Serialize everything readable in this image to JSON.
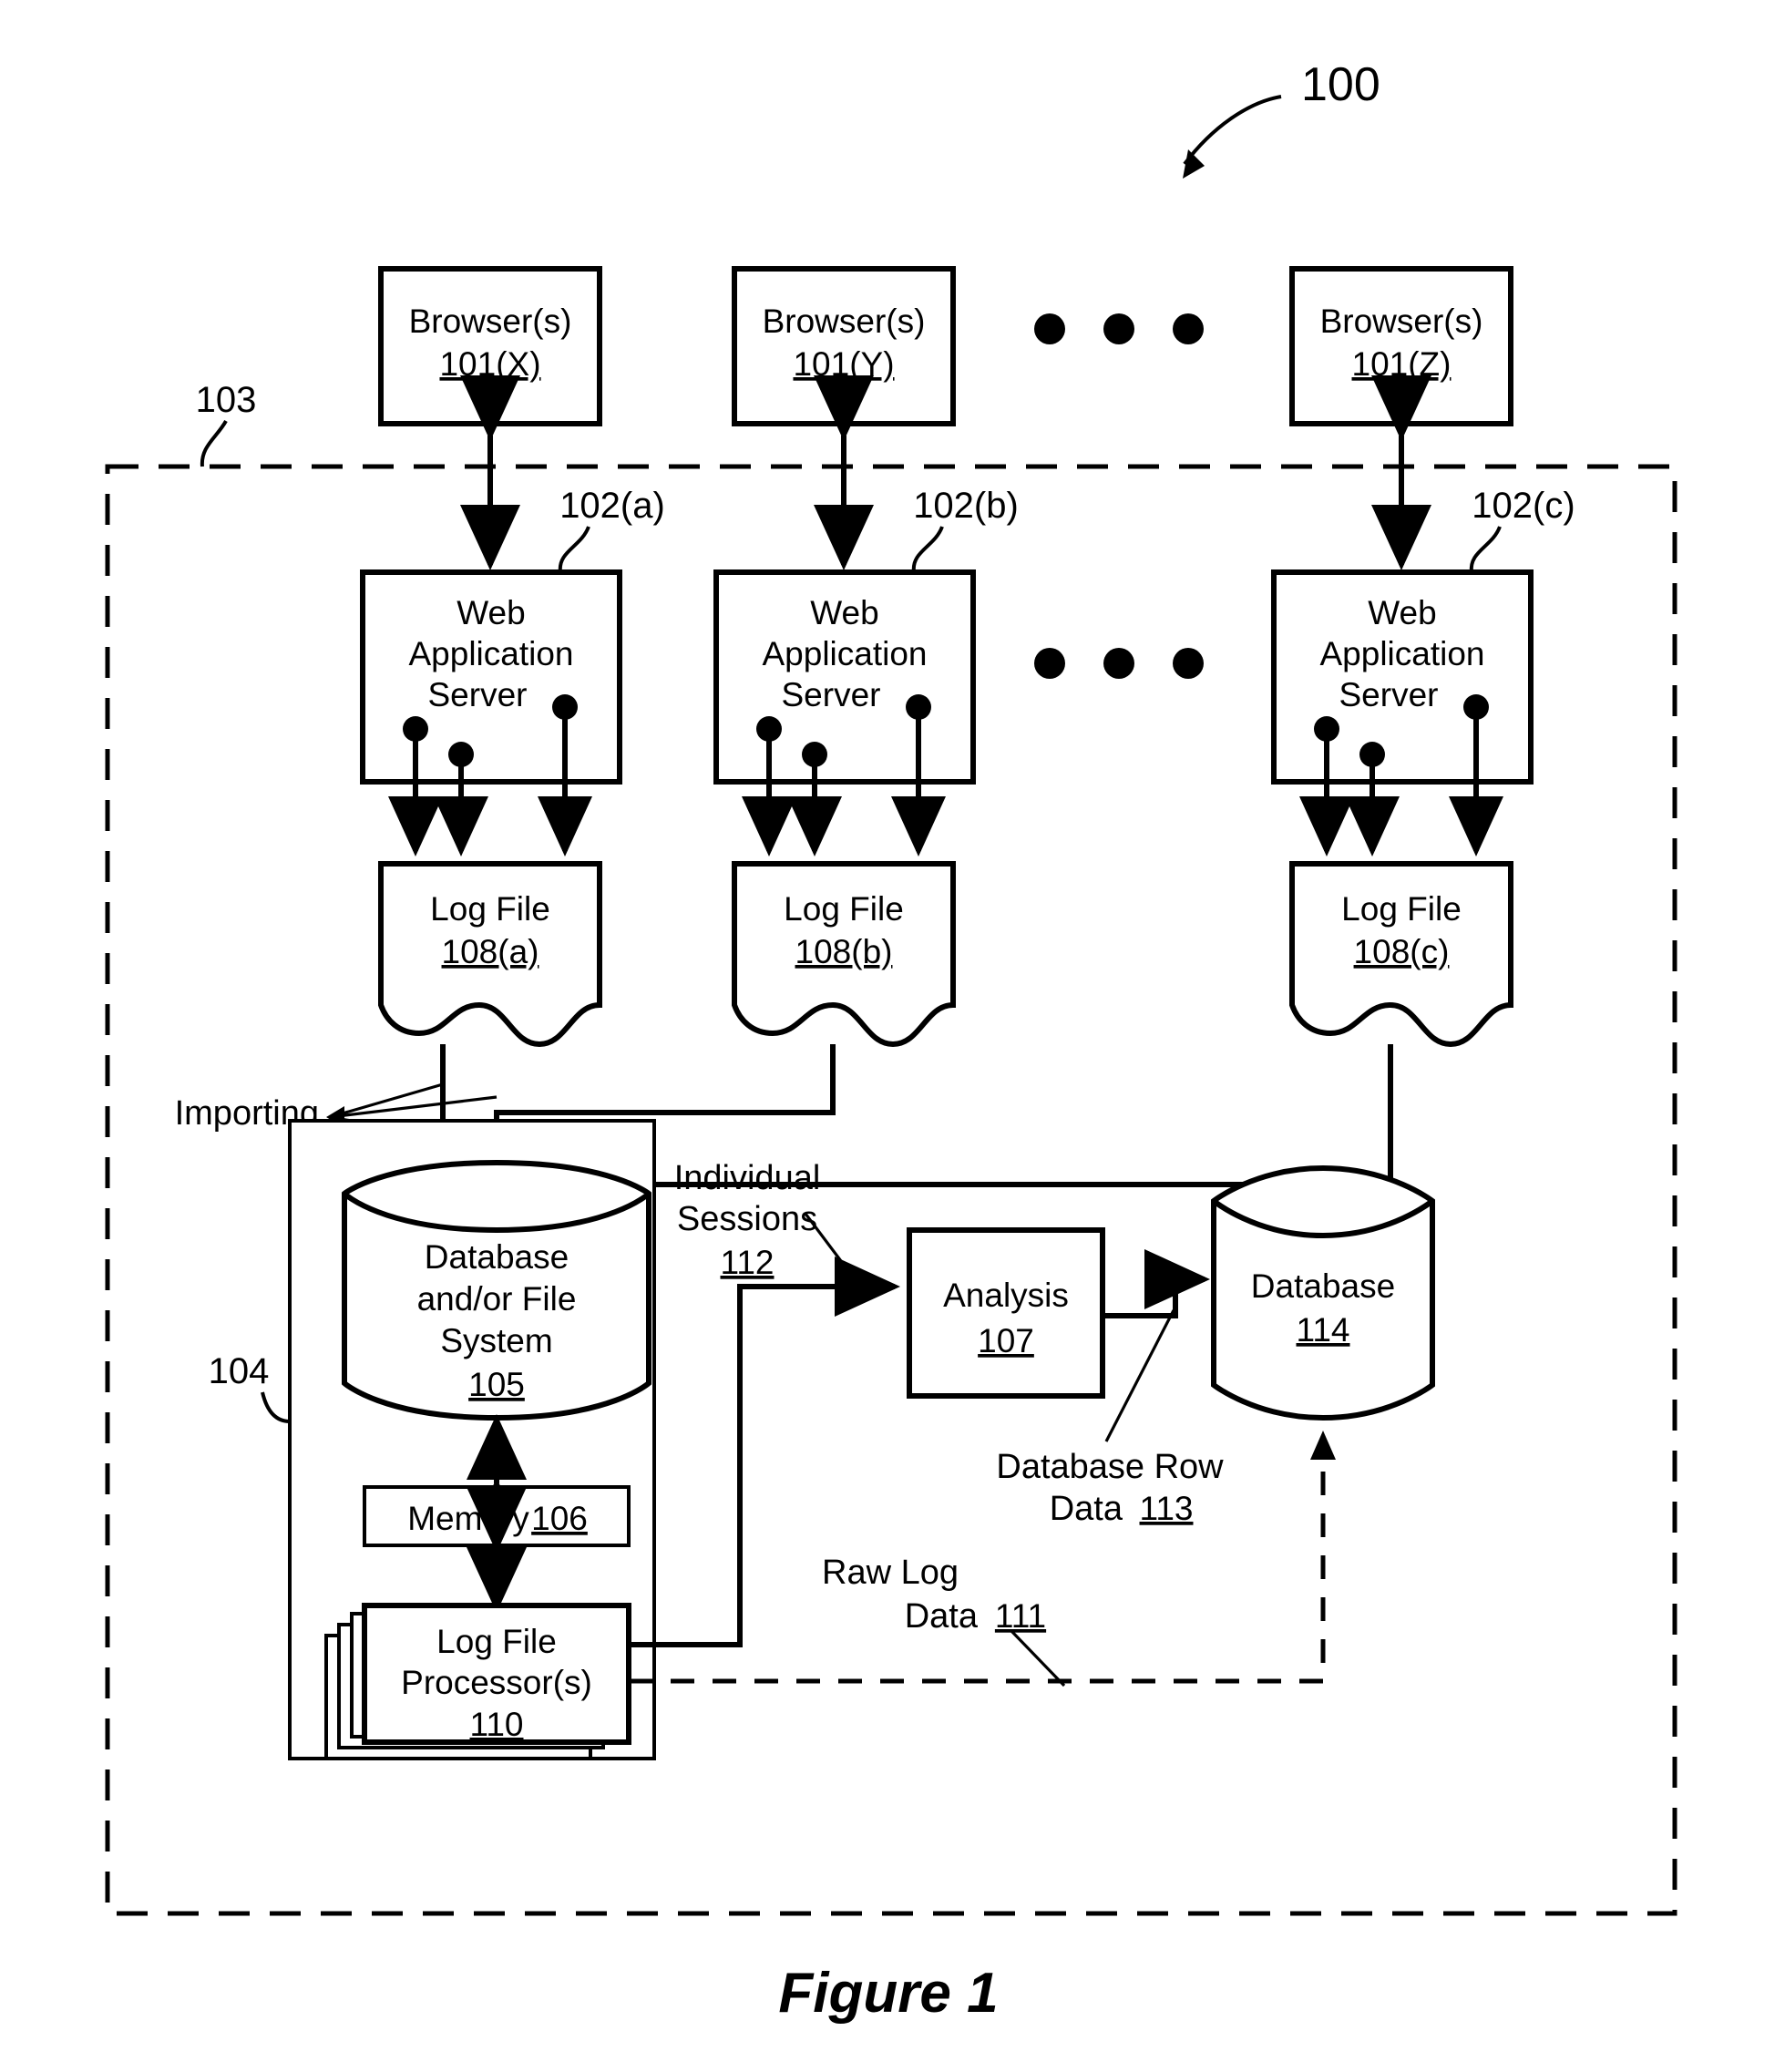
{
  "figure": {
    "caption": "Figure 1",
    "system_ref": "100",
    "boundary_ref": "103",
    "inner_boundary_ref": "104"
  },
  "browsers": [
    {
      "name": "Browser(s)",
      "ref": "101(X)"
    },
    {
      "name": "Browser(s)",
      "ref": "101(Y)"
    },
    {
      "name": "Browser(s)",
      "ref": "101(Z)"
    }
  ],
  "servers": [
    {
      "line1": "Web",
      "line2": "Application",
      "line3": "Server",
      "ref": "102(a)"
    },
    {
      "line1": "Web",
      "line2": "Application",
      "line3": "Server",
      "ref": "102(b)"
    },
    {
      "line1": "Web",
      "line2": "Application",
      "line3": "Server",
      "ref": "102(c)"
    }
  ],
  "log_files": [
    {
      "name": "Log File",
      "ref": "108(a)"
    },
    {
      "name": "Log File",
      "ref": "108(b)"
    },
    {
      "name": "Log File",
      "ref": "108(c)"
    }
  ],
  "importing_label": "Importing",
  "ellipsis": "• • •",
  "datastore": {
    "line1": "Database",
    "line2": "and/or File",
    "line3": "System",
    "ref": "105"
  },
  "memory": {
    "name": "Memory",
    "ref": "106"
  },
  "log_processor": {
    "line1": "Log File",
    "line2": "Processor(s)",
    "ref": "110"
  },
  "analysis": {
    "name": "Analysis",
    "ref": "107"
  },
  "database_out": {
    "name": "Database",
    "ref": "114"
  },
  "flow_labels": {
    "individual_sessions_l1": "Individual",
    "individual_sessions_l2": "Sessions",
    "individual_sessions_ref": "112",
    "db_row_data_l1": "Database Row",
    "db_row_data_l2": "Data",
    "db_row_data_ref": "113",
    "raw_log_l1": "Raw Log",
    "raw_log_l2": "Data",
    "raw_log_ref": "111"
  },
  "colors": {
    "ink": "#000000",
    "paper": "#ffffff"
  }
}
